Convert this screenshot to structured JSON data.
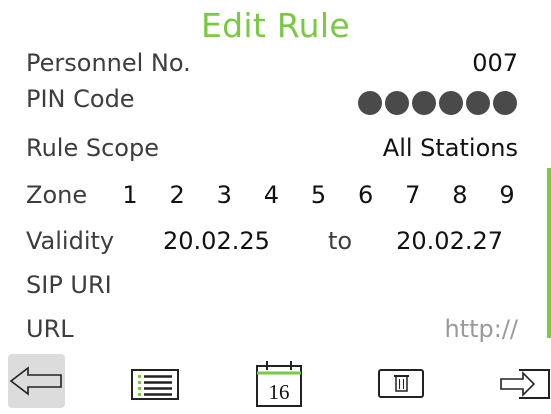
{
  "colors": {
    "accent": "#7ac943",
    "text": "#333333",
    "muted": "#9a9a9a",
    "pressed_button": "#dcdcdc"
  },
  "header": {
    "title": "Edit Rule"
  },
  "fields": {
    "personnel": {
      "label": "Personnel No.",
      "value": "007"
    },
    "pin": {
      "label": "PIN Code",
      "masked_digits": 6
    },
    "scope": {
      "label": "Rule Scope",
      "value": "All Stations"
    },
    "zone": {
      "label": "Zone",
      "values": [
        "1",
        "2",
        "3",
        "4",
        "5",
        "6",
        "7",
        "8",
        "9"
      ]
    },
    "validity": {
      "label": "Validity",
      "from": "20.02.25",
      "separator": "to",
      "until": "20.02.27"
    },
    "sip": {
      "label": "SIP URI",
      "value": ""
    },
    "url": {
      "label": "URL",
      "placeholder": "http://"
    }
  },
  "calendar": {
    "day": "16"
  },
  "toolbar": {
    "icons": [
      "back-arrow-icon",
      "list-icon",
      "calendar-icon",
      "delete-icon",
      "exit-icon"
    ]
  }
}
